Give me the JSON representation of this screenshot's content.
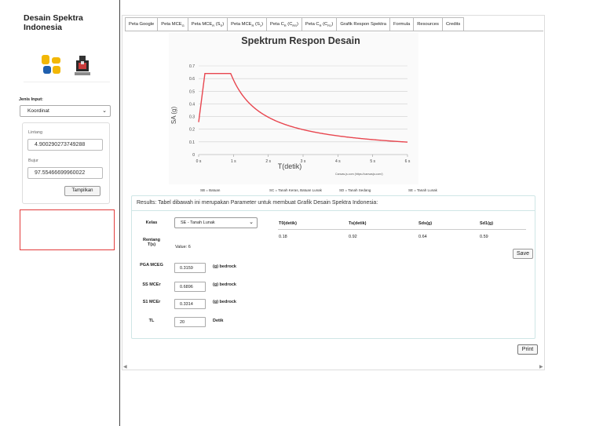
{
  "sidebar": {
    "title": "Desain Spektra Indonesia",
    "jenis_input_label": "Jenis Input:",
    "jenis_input_value": "Koordinat",
    "lintang_label": "Lintang",
    "lintang_value": "4.900290273749288",
    "bujur_label": "Bujur",
    "bujur_value": "97.55466699960022",
    "tampilkan_label": "Tampilkan"
  },
  "tabs": [
    {
      "label": "Peta Google",
      "active": true
    },
    {
      "label": "Peta MCEG",
      "active": false
    },
    {
      "label": "Peta MCER (SS)",
      "active": false
    },
    {
      "label": "Peta MCER (S1)",
      "active": false
    },
    {
      "label": "Peta CR (CRS)",
      "active": false
    },
    {
      "label": "Peta CR (CR1)",
      "active": false
    },
    {
      "label": "Grafik Respon Spektra",
      "active": false
    },
    {
      "label": "Formula",
      "active": false
    },
    {
      "label": "Resources",
      "active": false
    },
    {
      "label": "Credits",
      "active": false
    }
  ],
  "chart_data": {
    "type": "line",
    "title": "Spektrum Respon Desain",
    "xlabel": "T(detik)",
    "ylabel": "SA (g)",
    "xlim": [
      0,
      6
    ],
    "ylim": [
      0,
      0.7
    ],
    "x_ticks": [
      "0 s",
      "1 s",
      "2 s",
      "3 s",
      "4 s",
      "5 s",
      "6 s"
    ],
    "y_ticks": [
      "0",
      "0.1",
      "0.2",
      "0.3",
      "0.4",
      "0.5",
      "0.6",
      "0.7"
    ],
    "credit": "Canvas.js.com (https://canvasjs.com/)",
    "color": "#e8464f",
    "params": {
      "T0": 0.18,
      "Ts": 0.92,
      "SDS": 0.64,
      "SD1": 0.59,
      "TL": 20
    },
    "series": [
      {
        "points": "computed from params"
      }
    ]
  },
  "legend": {
    "sb": "SB = Batuan",
    "sc": "SC = Tanah Keras, Batuan Lunak",
    "sd": "SD = Tanah Sedang",
    "se": "SE = Tanah Lunak"
  },
  "results": {
    "header": "Results: Tabel dibawah ini merupakan Parameter untuk membuat Grafik Desain Spektra Indonesia:",
    "kelas_label": "Kelas",
    "kelas_value": "SE - Tanah Lunak",
    "rentang_label": "Rentang T(s)",
    "rentang_value": "Value: 6",
    "pga_label": "PGA MCEG",
    "pga_value": "0.3159",
    "pga_unit": "(g) bedrock",
    "ss_label": "SS MCEr",
    "ss_value": "0.6896",
    "ss_unit": "(g) bedrock",
    "s1_label": "S1 MCEr",
    "s1_value": "0.3314",
    "s1_unit": "(g) bedrock",
    "tl_label": "TL",
    "tl_value": "20",
    "tl_unit": "Detik",
    "table_headers": [
      "T0(detik)",
      "Ts(detik)",
      "Sds(g)",
      "Sd1(g)"
    ],
    "table_values": [
      "0.18",
      "0.92",
      "0.64",
      "0.59"
    ],
    "save_label": "Save"
  },
  "print_label": "Print"
}
